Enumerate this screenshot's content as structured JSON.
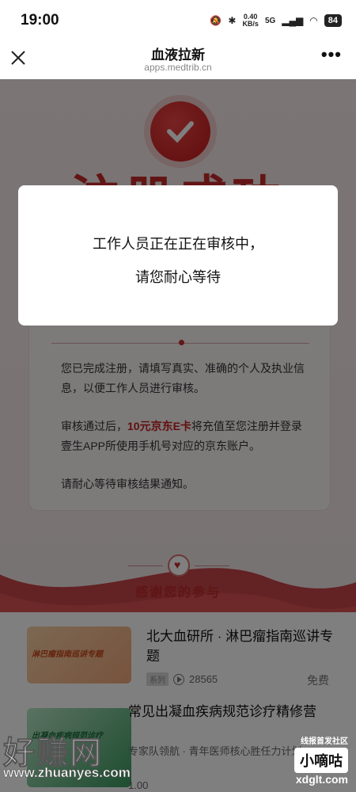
{
  "status_bar": {
    "time": "19:00",
    "net_rate": "0.40",
    "net_unit": "KB/s",
    "signal": "5G",
    "battery": "84"
  },
  "nav": {
    "title": "血液拉新",
    "subtitle": "apps.medtrib.cn",
    "more": "•••"
  },
  "background": {
    "big_title": "注册成功",
    "card": {
      "para1": "您已完成注册，请填写真实、准确的个人及执业信息，以便工作人员进行审核。",
      "para2_prefix": "审核通过后，",
      "para2_highlight": "10元京东E卡",
      "para2_suffix": "将充值至您注册并登录壹生APP所使用手机号对应的京东账户。",
      "para3": "请耐心等待审核结果通知。"
    },
    "thanks": "感谢您的参与"
  },
  "list": {
    "items": [
      {
        "title": "北大血研所 · 淋巴瘤指南巡讲专题",
        "thumb_text": "淋巴瘤指南巡讲专题",
        "tag": "系列",
        "views": "28565",
        "price": "免费"
      },
      {
        "title": "常见出凝血疾病规范诊疗精修营",
        "thumb_text": "出凝血疾病规范诊疗",
        "subtitle": "专家队领航 · 青年医师核心胜任力计划",
        "price_partial": "1.00"
      }
    ]
  },
  "dialog": {
    "line1": "工作人员正在正在审核中，",
    "line2": "请您耐心等待"
  },
  "watermark": {
    "left_logo": "好赚网",
    "left_url": "www.zhuanyes.com",
    "right_top": "线报首发社区",
    "right_box": "小嘀咕",
    "right_url": "xdglt.com"
  }
}
